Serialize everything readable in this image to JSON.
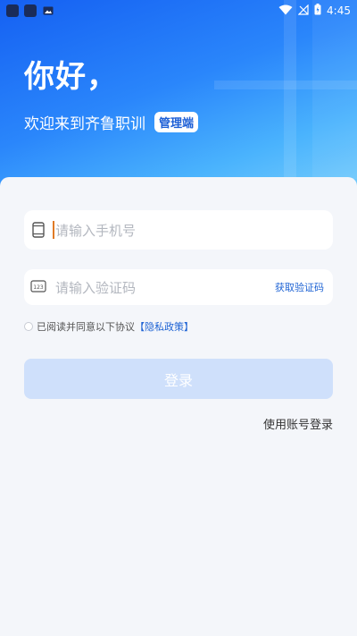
{
  "status_bar": {
    "time": "4:45"
  },
  "hero": {
    "greeting": "你好，",
    "welcome": "欢迎来到齐鲁职训",
    "badge": "管理端"
  },
  "form": {
    "phone": {
      "placeholder": "请输入手机号",
      "icon": "phone-icon"
    },
    "code": {
      "placeholder": "请输入验证码",
      "icon": "keypad-123-icon",
      "get_code_label": "获取验证码"
    },
    "agreement": {
      "text": "已阅读并同意以下协议",
      "policy_link": "【隐私政策】"
    },
    "login_button": "登录",
    "account_login_link": "使用账号登录"
  },
  "colors": {
    "accent": "#1e63d4",
    "login_button_disabled": "#cfe0fb",
    "background": "#f4f6fa"
  }
}
